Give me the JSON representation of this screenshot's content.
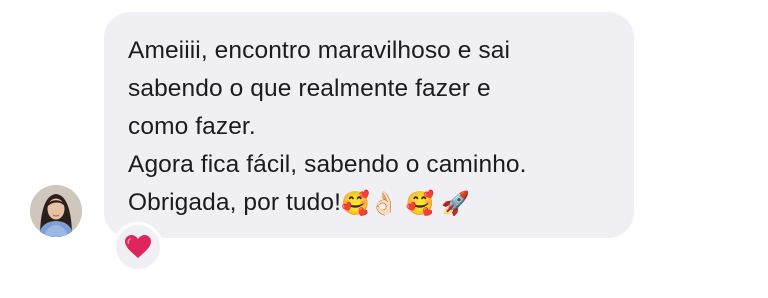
{
  "message": {
    "lines": [
      "Ameiiii, encontro maravilhoso e sai",
      "sabendo o que realmente fazer e",
      "como fazer.",
      "Agora fica fácil, sabendo o caminho.",
      "Obrigada, por tudo!"
    ],
    "emojis": [
      "🥰",
      "👌🏻",
      "🥰",
      "🚀"
    ]
  },
  "reaction": {
    "icon": "red-heart-icon",
    "emoji": "❤️",
    "color": "#e0245e"
  },
  "colors": {
    "bubble": "#efeff4",
    "text": "#1c1c1e",
    "background": "#ffffff"
  }
}
